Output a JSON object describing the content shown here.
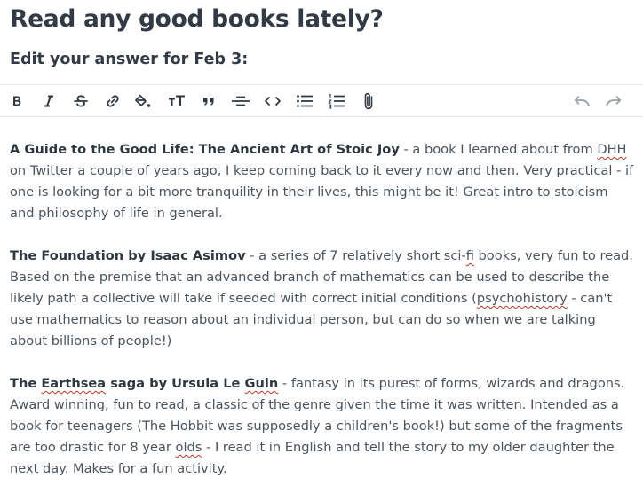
{
  "header": {
    "question": "Read any good books lately?",
    "subtitle": "Edit your answer for Feb 3:"
  },
  "toolbar": {
    "buttons": [
      {
        "name": "bold-icon",
        "label": "B"
      },
      {
        "name": "italic-icon",
        "label": "I"
      },
      {
        "name": "strikethrough-icon",
        "label": "S"
      },
      {
        "name": "link-icon"
      },
      {
        "name": "highlight-icon"
      },
      {
        "name": "text-size-icon"
      },
      {
        "name": "quote-icon"
      },
      {
        "name": "horizontal-rule-icon"
      },
      {
        "name": "code-icon"
      },
      {
        "name": "bulleted-list-icon"
      },
      {
        "name": "numbered-list-icon"
      },
      {
        "name": "attachment-icon"
      },
      {
        "name": "undo-icon"
      },
      {
        "name": "redo-icon"
      }
    ]
  },
  "entries": [
    {
      "title_parts": [
        "A Guide to the Good Life: The Ancient Art of Stoic Joy"
      ],
      "body_parts": [
        " - a book I learned about from ",
        "DHH",
        " on Twitter a couple of years ago, I keep coming back to it every now and then. Very practical - if one is looking for a bit more tranquility in their lives, this might be it! Great intro to stoicism and philosophy of life in general."
      ]
    },
    {
      "title_parts": [
        "The Foundation by Isaac Asimov"
      ],
      "body_parts": [
        " - a series of 7 relatively short sci-",
        "fi",
        " books, very fun to read. Based on the premise that an advanced branch of mathematics can be used to describe the likely path a collective will take if seeded with correct initial conditions (",
        "psychohistory",
        " - can't use mathematics to reason about an individual person, but can do so when we are talking about billions of people!)"
      ]
    },
    {
      "title_parts": [
        "The ",
        "Earthsea",
        " saga by Ursula Le ",
        "Guin"
      ],
      "body_parts": [
        " - fantasy in its purest of forms, wizards and dragons. Award winning, fun to read, a classic of the genre given the time it was written. Intended as a book for teenagers (The Hobbit was supposedly a children's book!) but some of the fragments are too drastic for 8 year ",
        "olds",
        " - I read it in English and tell the story to my older daughter the next day. Makes for a fun activity."
      ]
    }
  ]
}
